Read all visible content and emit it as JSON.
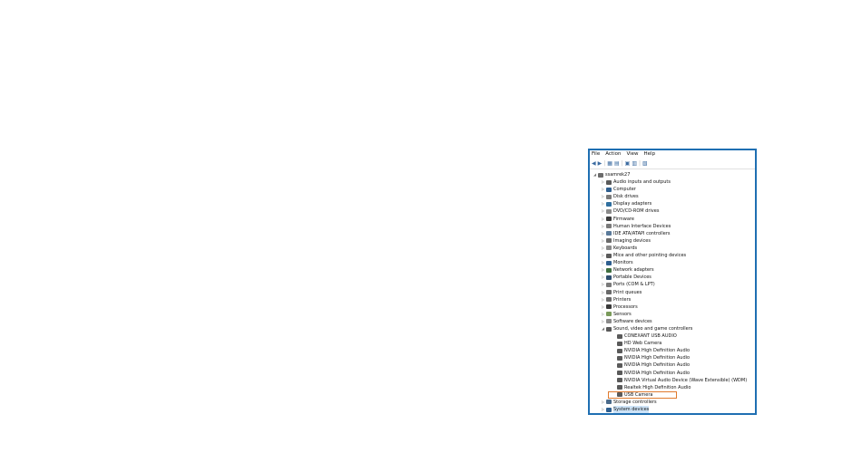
{
  "menu": [
    "File",
    "Action",
    "View",
    "Help"
  ],
  "toolbar_icons": [
    "back-arrow-icon",
    "forward-arrow-icon",
    "properties-icon",
    "list-icon",
    "help-icon",
    "view-icon",
    "device-monitor-icon"
  ],
  "tree": [
    {
      "label": "ssamrek27",
      "level": 0,
      "expander": "collapse",
      "icon": "computer-root-icon",
      "color": "#6b6b6b"
    },
    {
      "label": "Audio inputs and outputs",
      "level": 1,
      "expander": "expand",
      "icon": "speaker-icon",
      "color": "#5a5a5a"
    },
    {
      "label": "Computer",
      "level": 1,
      "expander": "expand",
      "icon": "monitor-icon",
      "color": "#2f5f8f"
    },
    {
      "label": "Disk drives",
      "level": 1,
      "expander": "expand",
      "icon": "disk-icon",
      "color": "#7a7a7a"
    },
    {
      "label": "Display adapters",
      "level": 1,
      "expander": "expand",
      "icon": "display-adapter-icon",
      "color": "#2f6f9f"
    },
    {
      "label": "DVD/CD-ROM drives",
      "level": 1,
      "expander": "expand",
      "icon": "dvd-icon",
      "color": "#8a8a8a"
    },
    {
      "label": "Firmware",
      "level": 1,
      "expander": "expand",
      "icon": "chip-icon",
      "color": "#3a3a3a"
    },
    {
      "label": "Human Interface Devices",
      "level": 1,
      "expander": "expand",
      "icon": "hid-icon",
      "color": "#7a7a7a"
    },
    {
      "label": "IDE ATA/ATAPI controllers",
      "level": 1,
      "expander": "expand",
      "icon": "controller-icon",
      "color": "#5a7a9a"
    },
    {
      "label": "Imaging devices",
      "level": 1,
      "expander": "expand",
      "icon": "camera-icon",
      "color": "#6a6a6a"
    },
    {
      "label": "Keyboards",
      "level": 1,
      "expander": "expand",
      "icon": "keyboard-icon",
      "color": "#8a8a8a"
    },
    {
      "label": "Mice and other pointing devices",
      "level": 1,
      "expander": "expand",
      "icon": "mouse-icon",
      "color": "#5a5a5a"
    },
    {
      "label": "Monitors",
      "level": 1,
      "expander": "expand",
      "icon": "monitor-icon",
      "color": "#2f5f8f"
    },
    {
      "label": "Network adapters",
      "level": 1,
      "expander": "expand",
      "icon": "network-icon",
      "color": "#3f6f3f"
    },
    {
      "label": "Portable Devices",
      "level": 1,
      "expander": "expand",
      "icon": "portable-device-icon",
      "color": "#2f4f6f"
    },
    {
      "label": "Ports (COM & LPT)",
      "level": 1,
      "expander": "expand",
      "icon": "port-icon",
      "color": "#7a7a7a"
    },
    {
      "label": "Print queues",
      "level": 1,
      "expander": "expand",
      "icon": "printer-icon",
      "color": "#6a6a6a"
    },
    {
      "label": "Printers",
      "level": 1,
      "expander": "expand",
      "icon": "printer-icon",
      "color": "#6a6a6a"
    },
    {
      "label": "Processors",
      "level": 1,
      "expander": "expand",
      "icon": "processor-icon",
      "color": "#3a3a3a"
    },
    {
      "label": "Sensors",
      "level": 1,
      "expander": "expand",
      "icon": "sensor-icon",
      "color": "#7a9a5a"
    },
    {
      "label": "Software devices",
      "level": 1,
      "expander": "expand",
      "icon": "software-icon",
      "color": "#8a8a8a"
    },
    {
      "label": "Sound, video and game controllers",
      "level": 1,
      "expander": "collapse",
      "icon": "speaker-icon",
      "color": "#5a5a5a"
    },
    {
      "label": "CONEXANT USB AUDIO",
      "level": 2,
      "expander": "none",
      "icon": "speaker-icon",
      "color": "#5a5a5a"
    },
    {
      "label": "HD Web Camera",
      "level": 2,
      "expander": "none",
      "icon": "speaker-icon",
      "color": "#5a5a5a"
    },
    {
      "label": "NVIDIA High Definition Audio",
      "level": 2,
      "expander": "none",
      "icon": "speaker-icon",
      "color": "#5a5a5a"
    },
    {
      "label": "NVIDIA High Definition Audio",
      "level": 2,
      "expander": "none",
      "icon": "speaker-icon",
      "color": "#5a5a5a"
    },
    {
      "label": "NVIDIA High Definition Audio",
      "level": 2,
      "expander": "none",
      "icon": "speaker-icon",
      "color": "#5a5a5a"
    },
    {
      "label": "NVIDIA High Definition Audio",
      "level": 2,
      "expander": "none",
      "icon": "speaker-icon",
      "color": "#5a5a5a"
    },
    {
      "label": "NVIDIA Virtual Audio Device (Wave Extensible) (WDM)",
      "level": 2,
      "expander": "none",
      "icon": "speaker-icon",
      "color": "#5a5a5a"
    },
    {
      "label": "Realtek High Definition Audio",
      "level": 2,
      "expander": "none",
      "icon": "speaker-icon",
      "color": "#5a5a5a"
    },
    {
      "label": "USB Camera",
      "level": 2,
      "expander": "none",
      "icon": "speaker-icon",
      "color": "#5a5a5a",
      "highlight": true
    },
    {
      "label": "Storage controllers",
      "level": 1,
      "expander": "expand",
      "icon": "storage-icon",
      "color": "#4a6a8a"
    },
    {
      "label": "System devices",
      "level": 1,
      "expander": "expand",
      "icon": "system-icon",
      "color": "#2f5f8f",
      "selected": true
    }
  ],
  "colors": {
    "window_border": "#1f6fb2",
    "highlight_box": "#e07a2e"
  }
}
